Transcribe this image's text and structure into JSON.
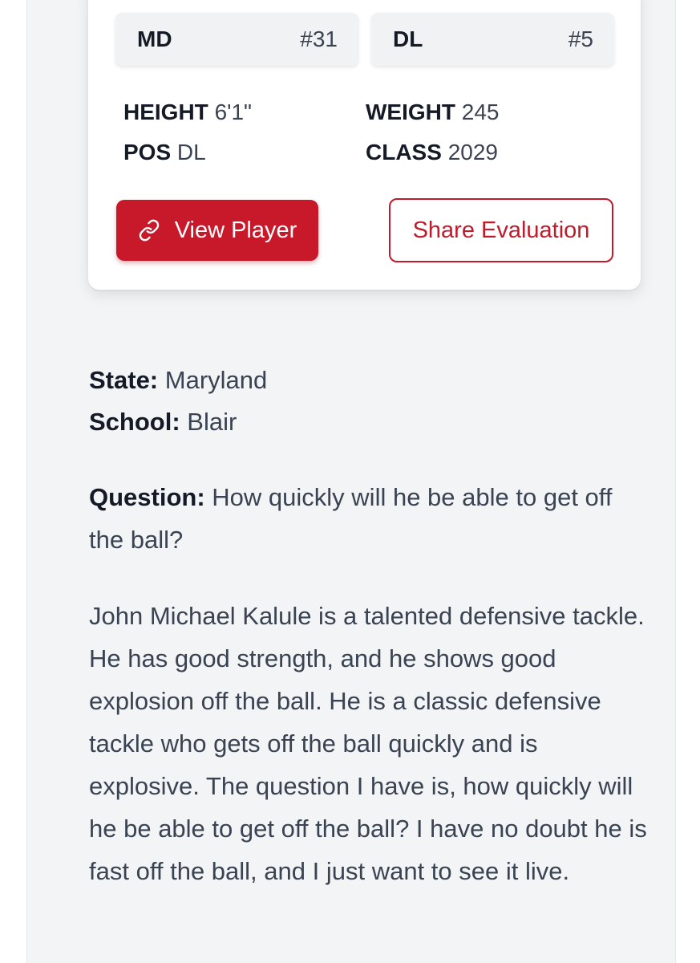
{
  "player_card": {
    "state_abbr": "MD",
    "jersey": "#31",
    "position_abbr": "DL",
    "position_rank": "#5",
    "stats": {
      "height_label": "HEIGHT",
      "height_value": "6'1\"",
      "weight_label": "WEIGHT",
      "weight_value": "245",
      "pos_label": "POS",
      "pos_value": "DL",
      "class_label": "CLASS",
      "class_value": "2029"
    },
    "buttons": {
      "view_player": "View Player",
      "view_player_icon": "link-icon",
      "share_evaluation": "Share Evaluation"
    }
  },
  "details": {
    "state_label": "State:",
    "state_value": "Maryland",
    "school_label": "School:",
    "school_value": "Blair",
    "question_label": "Question:",
    "question_text": "How quickly will he be able to get off the ball?"
  },
  "evaluation": "John Michael Kalule is a talented defensive tackle. He has good strength, and he shows good explosion off the ball. He is a classic defensive tackle who gets off the ball quickly and is explosive. The question I have is, how quickly will he be able to get off the ball? I have no doubt he is fast off the ball, and I just want to see it live.",
  "colors": {
    "brand_red": "#c8192a",
    "page_bg": "#f3f4f6",
    "card_bg": "#ffffff"
  }
}
